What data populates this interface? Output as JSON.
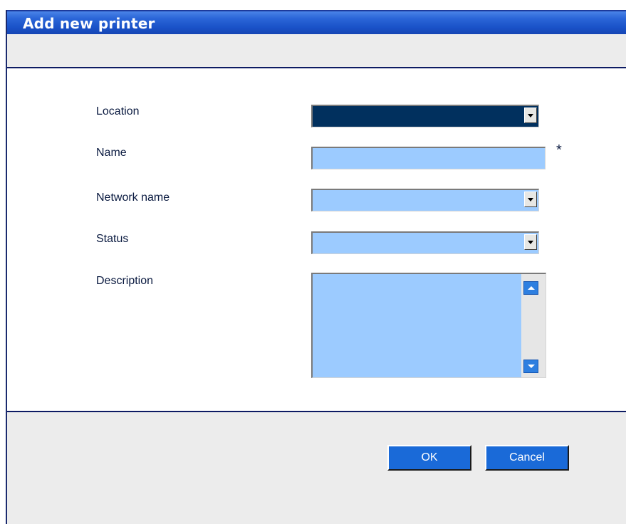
{
  "window": {
    "title": "Add new printer"
  },
  "form": {
    "location": {
      "label": "Location",
      "value": ""
    },
    "name": {
      "label": "Name",
      "value": "",
      "required_mark": "*"
    },
    "network_name": {
      "label": "Network name",
      "value": ""
    },
    "status": {
      "label": "Status",
      "value": ""
    },
    "description": {
      "label": "Description",
      "value": ""
    }
  },
  "buttons": {
    "ok": "OK",
    "cancel": "Cancel"
  },
  "icons": {
    "dropdown": "chevron-down-icon",
    "scroll_up": "scroll-up-icon",
    "scroll_down": "scroll-down-icon"
  },
  "colors": {
    "title_bar": "#2b66d8",
    "field_bg": "#9ccbff",
    "selected_field_bg": "#01305e",
    "button_bg": "#1a6ad8",
    "panel_bg": "#ececec",
    "divider": "#0d1b63"
  }
}
